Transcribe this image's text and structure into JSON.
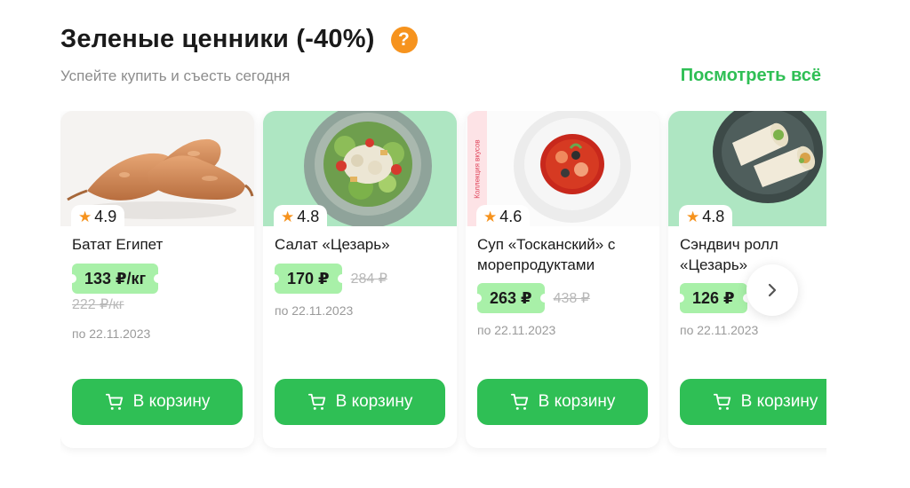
{
  "section": {
    "title": "Зеленые ценники (-40%)",
    "help_icon": "?",
    "subtitle": "Успейте купить и съесть сегодня",
    "see_all": "Посмотреть всё"
  },
  "colors": {
    "accent": "#2fbf55",
    "price_tag": "#a8f0a8",
    "star": "#f6931e",
    "help": "#f6931e"
  },
  "icons": {
    "rating": "star-icon",
    "cart_button": "cart-icon",
    "carousel_next": "chevron-right-icon",
    "help": "question-icon"
  },
  "products": [
    {
      "rating": "4.9",
      "name": "Батат Египет",
      "price": "133 ₽/кг",
      "old_price": "222 ₽/кг",
      "until": "по 22.11.2023",
      "button": "В корзину"
    },
    {
      "rating": "4.8",
      "name": "Салат «Цезарь»",
      "price": "170 ₽",
      "old_price": "284 ₽",
      "until": "по 22.11.2023",
      "button": "В корзину"
    },
    {
      "rating": "4.6",
      "name": "Суп «Тосканский» с морепродуктами",
      "price": "263 ₽",
      "old_price": "438 ₽",
      "until": "по 22.11.2023",
      "button": "В корзину",
      "ribbon": "Коллекция вкусов"
    },
    {
      "rating": "4.8",
      "name": "Сэндвич ролл «Цезарь»",
      "price": "126 ₽",
      "old_price": "",
      "until": "по 22.11.2023",
      "button": "В корзину"
    }
  ]
}
